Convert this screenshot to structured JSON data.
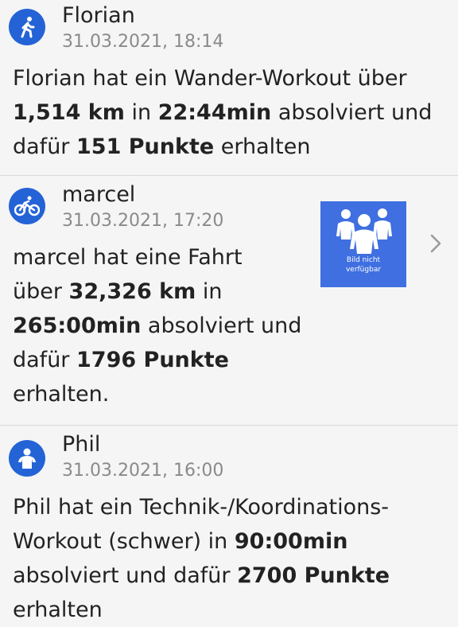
{
  "feed": [
    {
      "icon": "hiking-icon",
      "name": "Florian",
      "time": "31.03.2021, 18:14",
      "line1": {
        "t1": "Florian hat ein Wander-Workout über"
      },
      "line2": {
        "b1": "1,514 km",
        "t1": " in ",
        "b2": "22:44min",
        "t2": " absolviert und"
      },
      "line3": {
        "t1": "dafür ",
        "b1": "151 Punkte",
        "t2": " erhalten"
      }
    },
    {
      "icon": "bicycle-icon",
      "name": "marcel",
      "time": "31.03.2021, 17:20",
      "line1": {
        "t1": "marcel hat eine Fahrt"
      },
      "line2": {
        "t1": "über ",
        "b1": "32,326 km",
        "t2": " in"
      },
      "line3": {
        "b1": "265:00min",
        "t1": " absolviert und"
      },
      "line4": {
        "t1": "dafür ",
        "b1": "1796 Punkte"
      },
      "line5": {
        "t1": "erhalten."
      },
      "thumbnail": {
        "label_line1": "Bild nicht",
        "label_line2": "verfügbar"
      }
    },
    {
      "icon": "person-icon",
      "name": "Phil",
      "time": "31.03.2021, 16:00",
      "line1": {
        "t1": "Phil hat ein Technik-/Koordinations-"
      },
      "line2": {
        "t1": "Workout (schwer) in ",
        "b1": "90:00min"
      },
      "line3": {
        "t1": "absolviert und dafür ",
        "b1": "2700 Punkte"
      },
      "line4": {
        "t1": "erhalten"
      }
    }
  ],
  "colors": {
    "accent": "#2463d6",
    "thumbnail_bg": "#3f6fe0",
    "timestamp": "#8a8a8a"
  }
}
